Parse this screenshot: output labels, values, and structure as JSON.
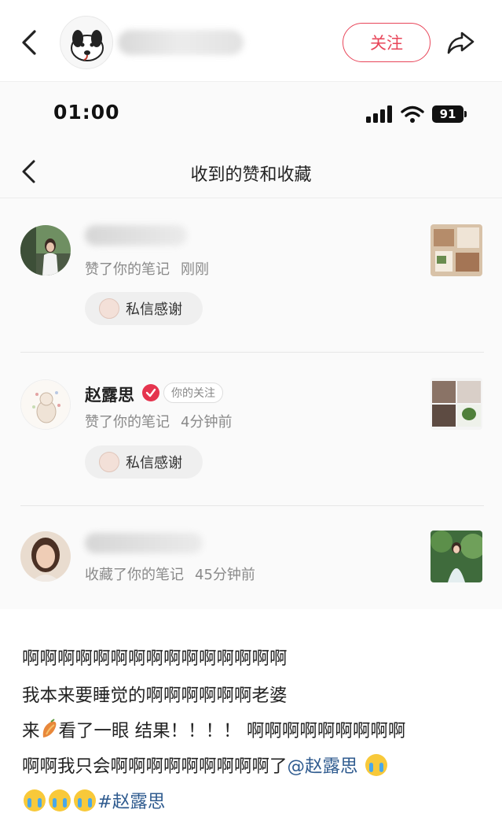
{
  "header": {
    "follow_label": "关注",
    "back_icon": "chevron-left-icon",
    "share_icon": "share-icon"
  },
  "status_bar": {
    "time": "01:00",
    "battery": "91"
  },
  "sub_nav": {
    "title": "收到的赞和收藏"
  },
  "notifications": [
    {
      "name": "",
      "action": "赞了你的笔记",
      "time": "刚刚",
      "button_label": "私信感谢"
    },
    {
      "name": "赵露思",
      "verified": true,
      "tag": "你的关注",
      "action": "赞了你的笔记",
      "time": "4分钟前",
      "button_label": "私信感谢"
    },
    {
      "name": "",
      "action": "收藏了你的笔记",
      "time": "45分钟前"
    }
  ],
  "caption": {
    "title": "啊啊啊啊啊啊啊啊啊啊啊啊啊啊啊",
    "line1": "我本来要睡觉的啊啊啊啊啊啊老婆",
    "line2_prefix": "来",
    "line2_rest": "看了一眼 结果！！！！ 啊啊啊啊啊啊啊啊啊",
    "line3_text": "啊啊我只会啊啊啊啊啊啊啊啊啊了",
    "mention": "@赵露思",
    "hashtag": "#赵露思"
  },
  "colors": {
    "accent": "#e8465a",
    "link": "#2f5b8f",
    "verified": "#e5344e"
  }
}
